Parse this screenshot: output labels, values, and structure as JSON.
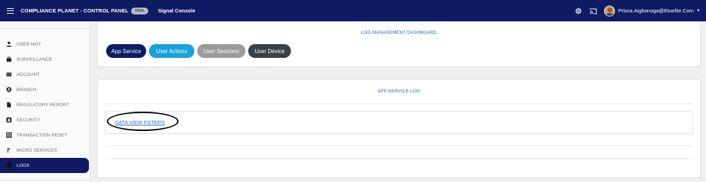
{
  "header": {
    "brand": "COMPLIANCE PLANET - CONTROL PANEL",
    "badge": "TRIAL",
    "console_title": "Signal Console",
    "user_email": "Prisca.Aigbonoga@Etuelite.Com",
    "icons": [
      "menu-icon",
      "gear-icon",
      "cast-icon",
      "avatar",
      "chevron-down-icon"
    ]
  },
  "sidebar": {
    "items": [
      {
        "label": "USER MGT",
        "icon": "person-icon"
      },
      {
        "label": "SURVEILLANCE",
        "icon": "briefcase-icon"
      },
      {
        "label": "ACCOUNT",
        "icon": "map-icon"
      },
      {
        "label": "BRANCH",
        "icon": "account-circle-icon"
      },
      {
        "label": "REGULATORY REPORT",
        "icon": "document-icon"
      },
      {
        "label": "SECURITY",
        "icon": "shield-icon"
      },
      {
        "label": "TRANSACTION RESET",
        "icon": "grid-icon"
      },
      {
        "label": "MICRO SERVICES",
        "icon": "fork-icon"
      },
      {
        "label": "LOGS",
        "icon": "logs-icon",
        "active": true
      }
    ]
  },
  "dashboard": {
    "title": "LOG MANAGEMENT DASHBOARD",
    "buttons": [
      {
        "label": "App Service",
        "color": "#0f1b63"
      },
      {
        "label": "User Actions",
        "color": "#17a2dc"
      },
      {
        "label": "User Sessions",
        "color": "#9b9b9b"
      },
      {
        "label": "User Device",
        "color": "#3a4147"
      }
    ]
  },
  "log_panel": {
    "title": "APP SERVICE LOG",
    "filters_link": "DATA VIEW FILTERS"
  },
  "colors": {
    "topbar": "#0f1b63",
    "accent_text": "#1a62b0",
    "link": "#2a6fc9"
  }
}
